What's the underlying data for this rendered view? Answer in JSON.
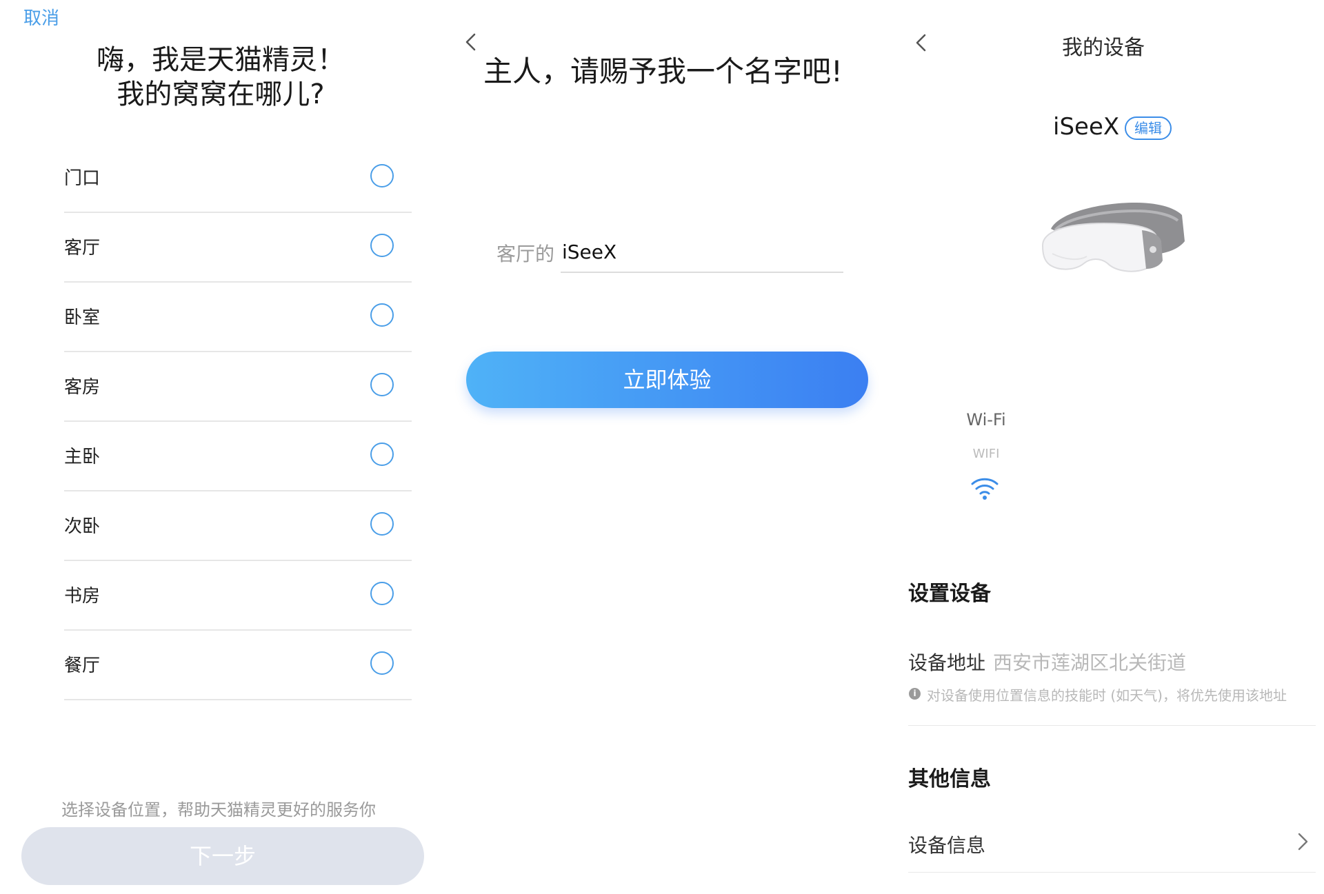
{
  "panel1": {
    "cancel": "取消",
    "title_line1": "嗨，我是天猫精灵！",
    "title_line2": "我的窝窝在哪儿?",
    "rooms": [
      "门口",
      "客厅",
      "卧室",
      "客房",
      "主卧",
      "次卧",
      "书房",
      "餐厅",
      ""
    ],
    "hint": "选择设备位置，帮助天猫精灵更好的服务你",
    "next_button": "下一步"
  },
  "panel2": {
    "title": "主人，请赐予我一个名字吧!",
    "name_prefix": "客厅的",
    "name_value": "iSeeX",
    "try_button": "立即体验"
  },
  "panel3": {
    "title": "我的设备",
    "device_name": "iSeeX",
    "edit_badge": "编辑",
    "wifi_label": "Wi-Fi",
    "wifi_sub": "WIFI",
    "section_setup": "设置设备",
    "address_label": "设备地址",
    "address_value": "西安市莲湖区北关街道",
    "address_note": "对设备使用位置信息的技能时 (如天气)，将优先使用该地址",
    "section_other": "其他信息",
    "device_info": "设备信息"
  },
  "colors": {
    "accent": "#4a9ee8",
    "button_gradient_start": "#4fb2f7",
    "button_gradient_end": "#3b7ff2",
    "disabled_button": "#dfe3ec"
  }
}
